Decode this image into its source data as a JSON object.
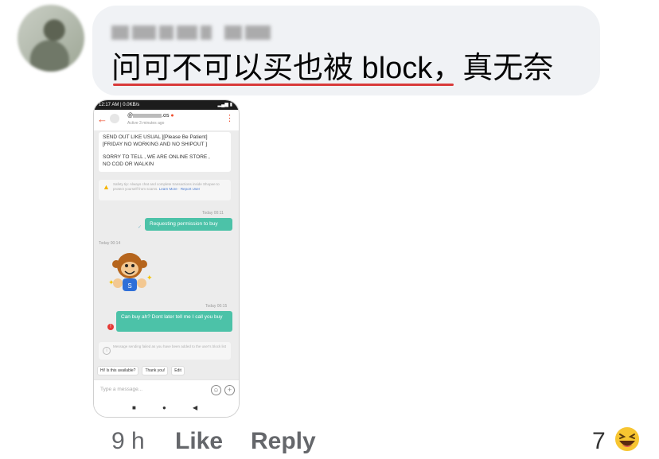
{
  "comment": {
    "text": "问可不可以买也被 block，真无奈",
    "time": "9 h",
    "like_label": "Like",
    "reply_label": "Reply",
    "reaction_count": "7",
    "reaction_icon": "laughing-emoji-icon"
  },
  "phone": {
    "status_time": "12:17 AM | 0.0KB/s",
    "header": {
      "username_prefix": "@",
      "username_suffix": ".os",
      "status": "Active 3 minutes ago"
    },
    "seller_message": {
      "line1": "SEND OUT LIKE USUAL ][Please Be Patient]",
      "line2": "[FRIDAY NO WORKING AND NO SHIPOUT ]",
      "line3": "SORRY TO TELL , WE ARE ONLINE STORE ,",
      "line4": "NO COD OR WALKIN"
    },
    "warning": {
      "text": "Safety tip: Always chat and complete transactions inside Shopee to protect yourself from scams.",
      "learn_more": "Learn More",
      "report_user": "Report User"
    },
    "messages": [
      {
        "timestamp": "Today 00:11",
        "text": "Requesting permission to buy"
      },
      {
        "timestamp": "Today 00:14"
      },
      {
        "timestamp": "Today 00:15",
        "text": "Can buy ah? Dont later tell me I call you buy"
      }
    ],
    "notice": "Message sending failed as you have been added to the user's block list",
    "chips": [
      "Hi! Is this available?",
      "Thank you!",
      "Edit"
    ],
    "input_placeholder": "Type a message..."
  }
}
